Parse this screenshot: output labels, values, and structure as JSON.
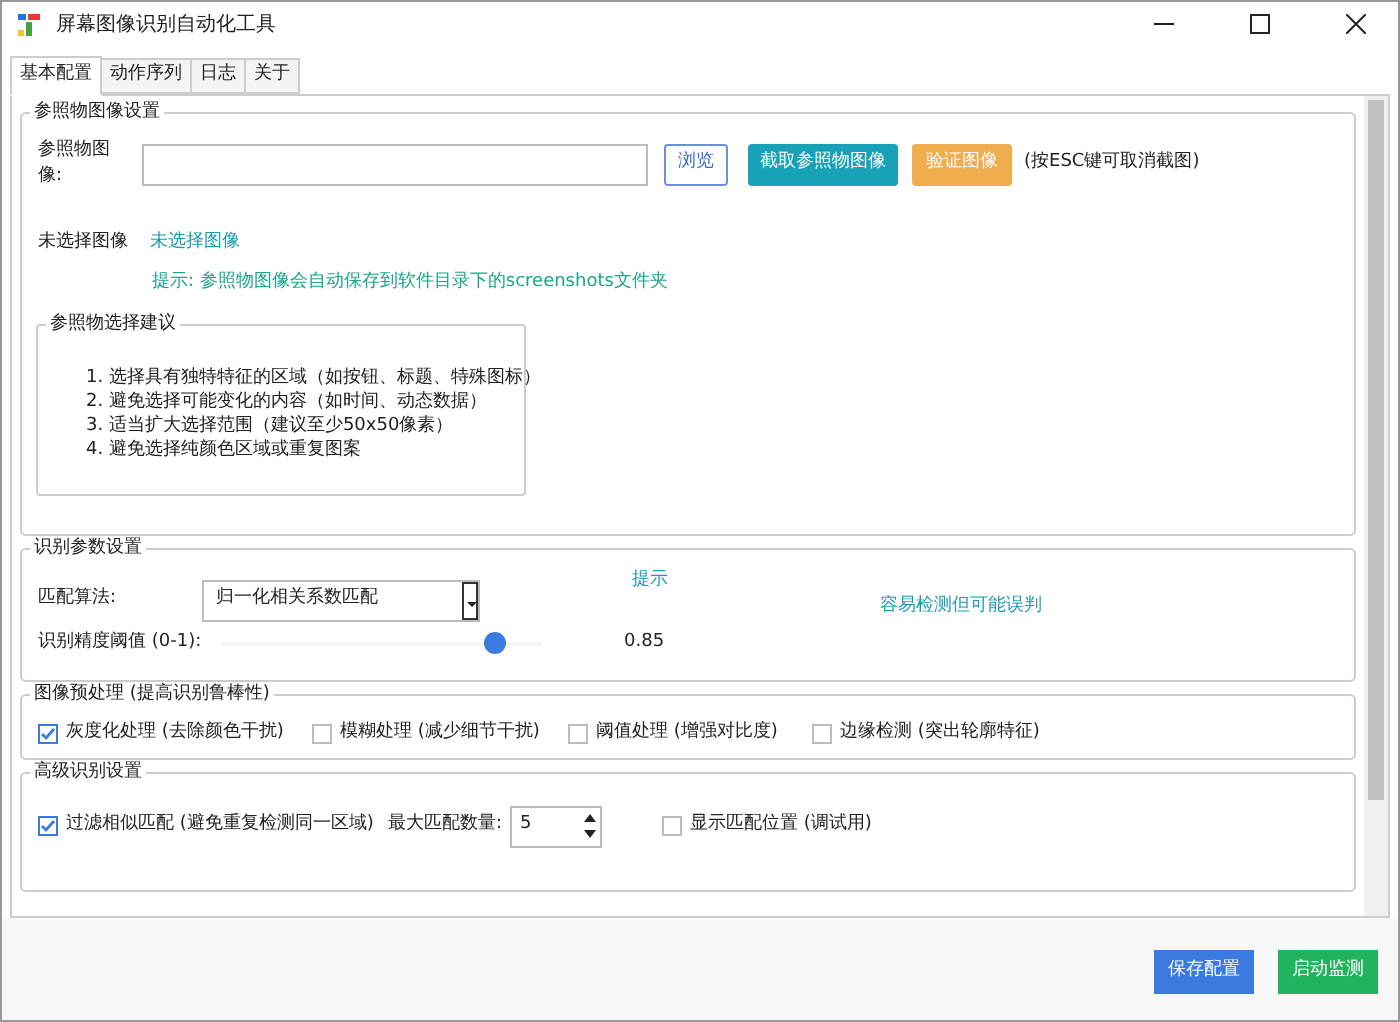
{
  "window": {
    "title": "屏幕图像识别自动化工具"
  },
  "tabs": [
    {
      "label": "基本配置",
      "selected": true
    },
    {
      "label": "动作序列",
      "selected": false
    },
    {
      "label": "日志",
      "selected": false
    },
    {
      "label": "关于",
      "selected": false
    }
  ],
  "reference_group": {
    "title": "参照物图像设置",
    "image_label": "参照物图像:",
    "browse_button": "浏览",
    "capture_button": "截取参照物图像",
    "verify_button": "验证图像",
    "esc_note": "(按ESC键可取消截图)",
    "status_label": "未选择图像",
    "status_value": "未选择图像",
    "save_hint": "提示: 参照物图像会自动保存到软件目录下的screenshots文件夹",
    "tips_group": {
      "title": "参照物选择建议",
      "items": [
        "1. 选择具有独特特征的区域（如按钮、标题、特殊图标）",
        "2. 避免选择可能变化的内容（如时间、动态数据）",
        "3. 适当扩大选择范围（建议至少50x50像素）",
        "4. 避免选择纯颜色区域或重复图案"
      ]
    }
  },
  "recognition_group": {
    "title": "识别参数设置",
    "algorithm_label": "匹配算法:",
    "algorithm_value": "归一化相关系数匹配",
    "hint_line_1": "提示",
    "hint_line_2": "容易检测但可能误判",
    "threshold_label": "识别精度阈值 (0-1):",
    "threshold": {
      "level": 0.85
    },
    "threshold_reading": "0.85"
  },
  "preprocess_group": {
    "title": "图像预处理 (提高识别鲁棒性)",
    "options": [
      {
        "label": "灰度化处理 (去除颜色干扰)",
        "checked": true
      },
      {
        "label": "模糊处理 (减少细节干扰)",
        "checked": false
      },
      {
        "label": "阈值处理 (增强对比度)",
        "checked": false
      },
      {
        "label": "边缘检测 (突出轮廓特征)",
        "checked": false
      }
    ]
  },
  "advanced_group": {
    "title": "高级识别设置",
    "filter_similar": {
      "label": "过滤相似匹配 (避免重复检测同一区域)",
      "checked": true
    },
    "max_matches_label": "最大匹配数量:",
    "max_matches": "5",
    "show_positions": {
      "label": "显示匹配位置 (调试用)",
      "checked": false
    }
  },
  "buttons": [
    {
      "label": "保存配置",
      "kind": "save"
    },
    {
      "label": "启动监测",
      "kind": "start"
    }
  ]
}
